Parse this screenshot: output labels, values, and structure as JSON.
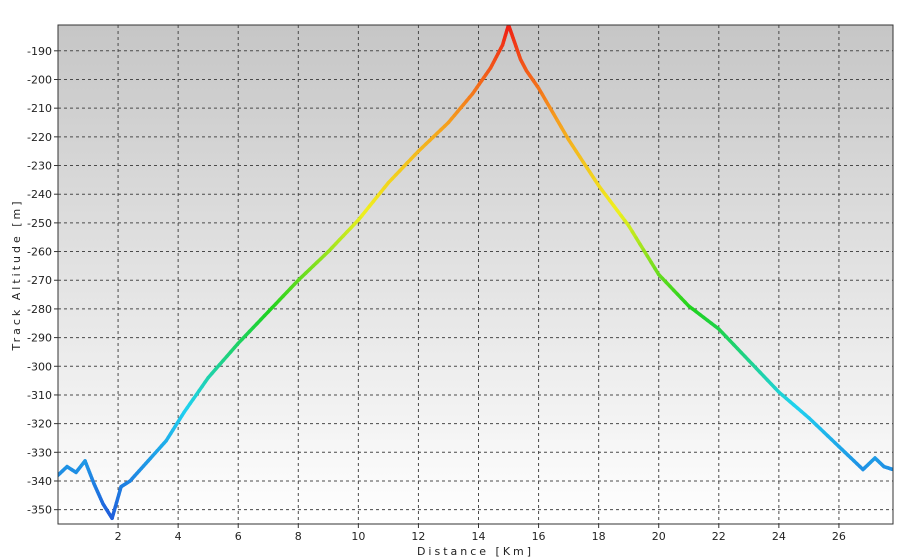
{
  "chart_data": {
    "type": "line",
    "title": "",
    "xlabel": "Distance [Km]",
    "ylabel": "Track Altitude [m]",
    "xlim": [
      0,
      27.8
    ],
    "ylim": [
      -355,
      -181
    ],
    "x_ticks": [
      2,
      4,
      6,
      8,
      10,
      12,
      14,
      16,
      18,
      20,
      22,
      24,
      26
    ],
    "y_ticks": [
      -190,
      -200,
      -210,
      -220,
      -230,
      -240,
      -250,
      -260,
      -270,
      -280,
      -290,
      -300,
      -310,
      -320,
      -330,
      -340,
      -350
    ],
    "grid": true,
    "legend": "none",
    "color_scale": "altitude gradient blue to red",
    "colors": {
      "low": "#1f5fdc",
      "cyan": "#1fd2f0",
      "green": "#1ed21e",
      "yellow": "#f0f01e",
      "orange": "#f5a01e",
      "high": "#f01e14",
      "plot_bg_top": "#c6c6c6",
      "plot_bg_bottom": "#ffffff",
      "grid": "#4a4a4a"
    },
    "series": [
      {
        "x": [
          0,
          0.3,
          0.6,
          0.9,
          1.2,
          1.5,
          1.8,
          2.1,
          2.4,
          3,
          3.6,
          4.2,
          5,
          6,
          7,
          8,
          9,
          10,
          11,
          12,
          13,
          13.8,
          14.4,
          14.8,
          15,
          15.2,
          15.4,
          15.6,
          16,
          17,
          18,
          19,
          20,
          21,
          22,
          23,
          24,
          25,
          26,
          26.8,
          27.2,
          27.5,
          27.8
        ],
        "y": [
          -338,
          -335,
          -337,
          -333,
          -341,
          -348,
          -353,
          -342,
          -340,
          -333,
          -326,
          -316,
          -304,
          -292,
          -281,
          -270,
          -260,
          -249,
          -236,
          -225,
          -215,
          -205,
          -196,
          -188,
          -181,
          -187,
          -193,
          -197,
          -203,
          -221,
          -237,
          -251,
          -268,
          -279,
          -287,
          -298,
          -309,
          -318,
          -328,
          -336,
          -332,
          -335,
          -336
        ]
      }
    ]
  }
}
